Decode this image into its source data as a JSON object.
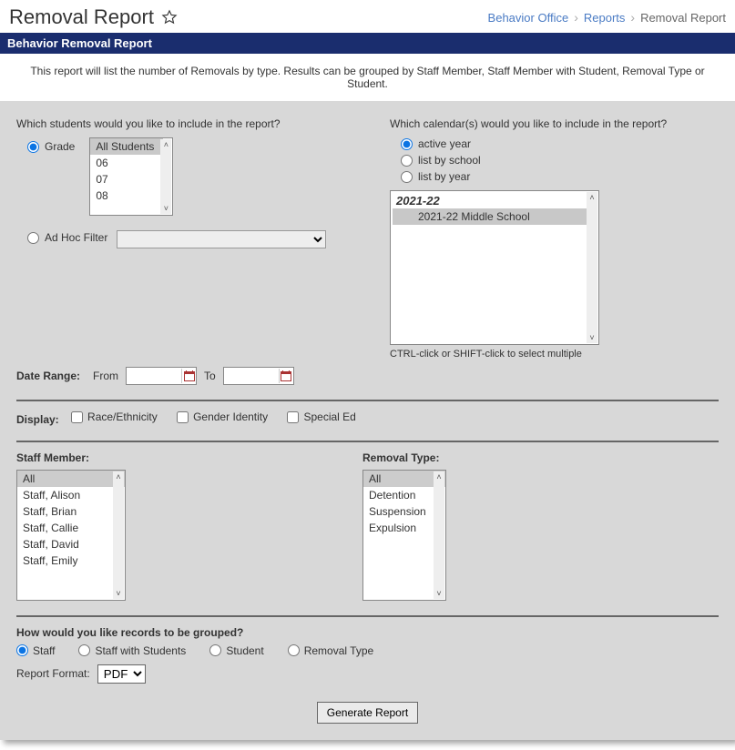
{
  "header": {
    "title": "Removal Report",
    "breadcrumb": {
      "items": [
        "Behavior Office",
        "Reports"
      ],
      "current": "Removal Report"
    }
  },
  "subheader": "Behavior Removal Report",
  "description": "This report will list the number of Removals by type. Results can be grouped by Staff Member, Staff Member with Student, Removal Type or Student.",
  "students": {
    "question": "Which students would you like to include in the report?",
    "options": {
      "grade_label": "Grade",
      "adhoc_label": "Ad Hoc Filter"
    },
    "selected": "grade",
    "grade_list": [
      "All Students",
      "06",
      "07",
      "08"
    ],
    "grade_selected": "All Students"
  },
  "calendars": {
    "question": "Which calendar(s) would you like to include in the report?",
    "options": {
      "active_year": "active year",
      "list_by_school": "list by school",
      "list_by_year": "list by year"
    },
    "selected": "active_year",
    "tree": {
      "year": "2021-22",
      "items": [
        "2021-22 Middle School"
      ],
      "selected": "2021-22 Middle School"
    },
    "hint": "CTRL-click or SHIFT-click to select multiple"
  },
  "date_range": {
    "label": "Date Range:",
    "from_label": "From",
    "to_label": "To",
    "from_value": "",
    "to_value": ""
  },
  "display": {
    "label": "Display:",
    "race": "Race/Ethnicity",
    "gender": "Gender Identity",
    "specialed": "Special Ed"
  },
  "staff": {
    "label": "Staff Member:",
    "items": [
      "All",
      "Staff, Alison",
      "Staff, Brian",
      "Staff, Callie",
      "Staff, David",
      "Staff, Emily"
    ],
    "selected": "All"
  },
  "removal": {
    "label": "Removal Type:",
    "items": [
      "All",
      "Detention",
      "Suspension",
      "Expulsion"
    ],
    "selected": "All"
  },
  "grouping": {
    "question": "How would you like records to be grouped?",
    "options": {
      "staff": "Staff",
      "staff_students": "Staff with Students",
      "student": "Student",
      "removal_type": "Removal Type"
    },
    "selected": "staff"
  },
  "format": {
    "label": "Report Format:",
    "selected": "PDF",
    "options": [
      "PDF"
    ]
  },
  "buttons": {
    "generate": "Generate Report"
  }
}
